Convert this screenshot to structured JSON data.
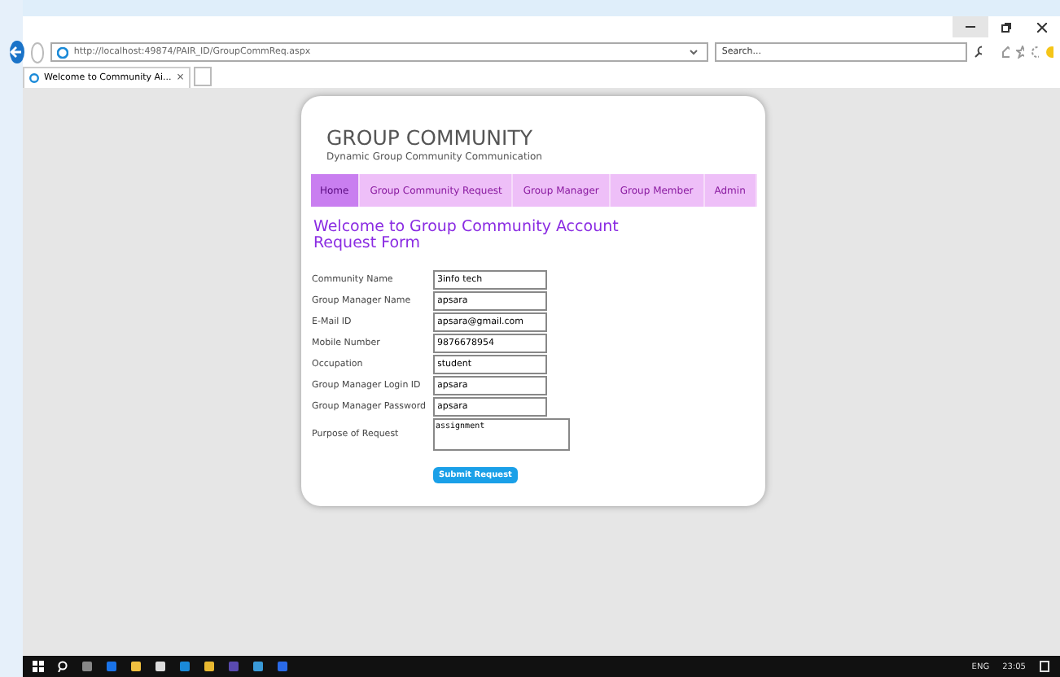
{
  "browser": {
    "address": "http://localhost:49874/PAIR_ID/GroupCommReq.aspx",
    "search": {
      "placeholder": "Search..."
    },
    "tab": {
      "title": "Welcome to Community Ai...",
      "close": "×"
    }
  },
  "page": {
    "title": "GROUP COMMUNITY",
    "subtitle": "Dynamic Group Community Communication",
    "nav": [
      {
        "label": "Home",
        "selected": true
      },
      {
        "label": "Group Community Request",
        "selected": false
      },
      {
        "label": "Group Manager",
        "selected": false
      },
      {
        "label": "Group Member",
        "selected": false
      },
      {
        "label": "Admin",
        "selected": false
      }
    ],
    "heading": "Welcome to Group Community Account Request Form",
    "fields": [
      {
        "label": "Community Name",
        "value": "3info tech",
        "kind": "text"
      },
      {
        "label": "Group Manager Name",
        "value": "apsara",
        "kind": "text"
      },
      {
        "label": "E-Mail ID",
        "value": "apsara@gmail.com",
        "kind": "text"
      },
      {
        "label": "Mobile Number",
        "value": "9876678954",
        "kind": "text"
      },
      {
        "label": "Occupation",
        "value": "student",
        "kind": "text"
      },
      {
        "label": "Group Manager Login ID",
        "value": "apsara",
        "kind": "text"
      },
      {
        "label": "Group Manager Password",
        "value": "apsara",
        "kind": "text"
      },
      {
        "label": "Purpose of Request",
        "value": "assignment",
        "kind": "textarea"
      }
    ],
    "submit": "Submit Request"
  },
  "taskbar": {
    "language": "ENG",
    "time": "23:05"
  }
}
